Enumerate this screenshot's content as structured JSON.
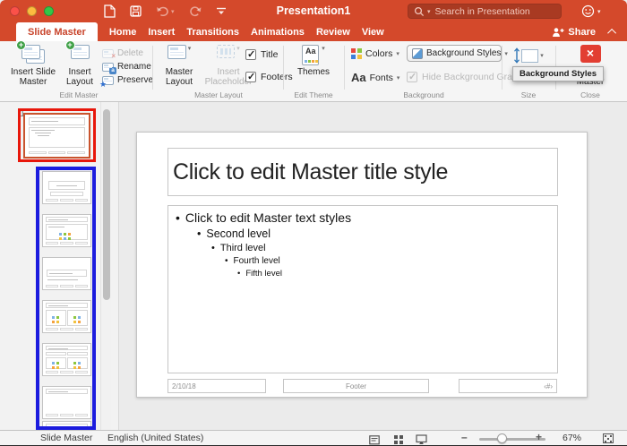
{
  "window": {
    "title": "Presentation1"
  },
  "titlebar": {
    "search_placeholder": "Search in Presentation"
  },
  "tabs": [
    {
      "label": "Slide Master",
      "active": true
    },
    {
      "label": "Home"
    },
    {
      "label": "Insert"
    },
    {
      "label": "Transitions"
    },
    {
      "label": "Animations"
    },
    {
      "label": "Review"
    },
    {
      "label": "View"
    }
  ],
  "share_label": "Share",
  "ribbon": {
    "edit_master": {
      "group_label": "Edit Master",
      "insert_slide_master": "Insert Slide Master",
      "insert_layout": "Insert Layout",
      "delete": "Delete",
      "rename": "Rename",
      "preserve": "Preserve"
    },
    "master_layout": {
      "group_label": "Master Layout",
      "master_layout": "Master Layout",
      "insert_placeholder": "Insert Placeholder",
      "title_checkbox": "Title",
      "footers_checkbox": "Footers"
    },
    "edit_theme": {
      "group_label": "Edit Theme",
      "themes": "Themes"
    },
    "background": {
      "group_label": "Background",
      "colors": "Colors",
      "background_styles": "Background Styles",
      "fonts": "Fonts",
      "hide_background_graphics": "Hide Background Grap"
    },
    "size": {
      "group_label": "Size",
      "size_button": "Size"
    },
    "close": {
      "group_label": "Close",
      "close_master": "Close Master"
    },
    "tooltip": "Background Styles"
  },
  "thumbnails": {
    "slide_index": "1",
    "annotations": {
      "master_highlight_color": "#E8170B",
      "layouts_highlight_color": "#1C1CDE"
    }
  },
  "slide": {
    "title_placeholder": "Click to edit Master title style",
    "bullets": [
      "Click to edit Master text styles",
      "Second level",
      "Third level",
      "Fourth level",
      "Fifth level"
    ],
    "date": "2/10/18",
    "footer": "Footer",
    "slide_number": "‹#›"
  },
  "statusbar": {
    "view_label": "Slide Master",
    "language": "English (United States)",
    "zoom_percent": "67%"
  },
  "colors": {
    "titlebar_red": "#D4492B",
    "active_tab_text": "#C8432A",
    "close_master_red": "#E23E32"
  }
}
